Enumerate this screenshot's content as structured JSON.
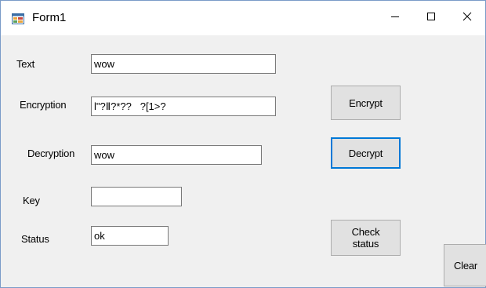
{
  "window": {
    "title": "Form1",
    "icon": "winforms-app-icon"
  },
  "controls": {
    "minimize_icon": "minimize-icon",
    "maximize_icon": "maximize-icon",
    "close_icon": "close-icon"
  },
  "fields": {
    "text_label": "Text",
    "text_value": "wow",
    "encryption_label": "Encryption",
    "encryption_value": "l\"?Ⅱ?*??   ?[1>?",
    "decryption_label": "Decryption",
    "decryption_value": "wow",
    "key_label": "Key",
    "key_value": "",
    "status_label": "Status",
    "status_value": "ok"
  },
  "buttons": {
    "encrypt": "Encrypt",
    "decrypt": "Decrypt",
    "check_status_line1": "Check",
    "check_status_line2": "status",
    "clear": "Clear"
  },
  "colors": {
    "focus_border": "#0078d7",
    "window_border": "#7a9bc8",
    "form_background": "#f0f0f0",
    "button_face": "#e1e1e1"
  }
}
